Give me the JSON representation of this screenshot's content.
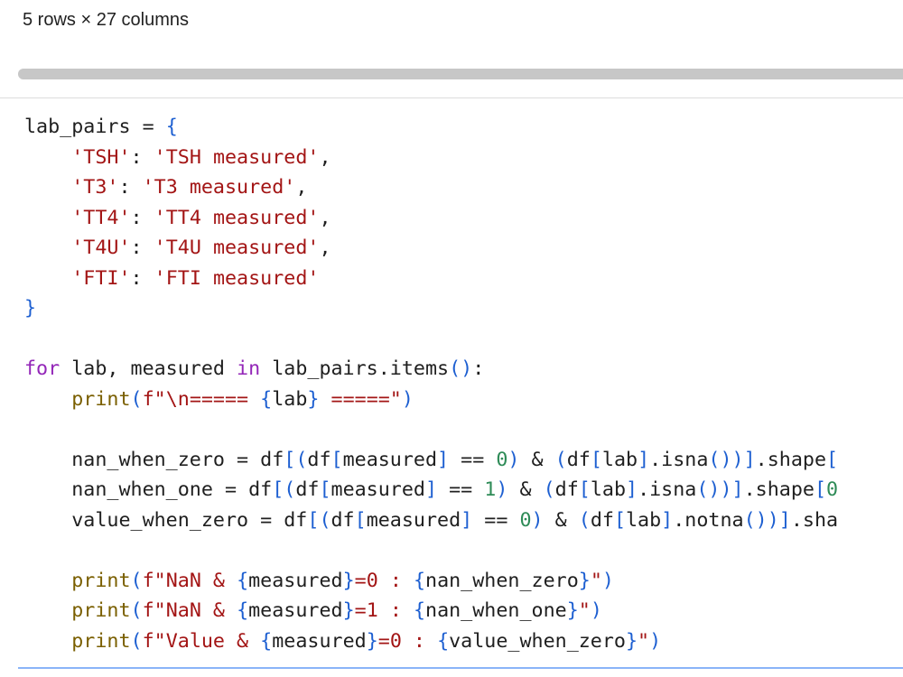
{
  "output": {
    "shape_info": "5 rows × 27 columns"
  },
  "code": {
    "lines": [
      "lab_pairs = {",
      "    'TSH': 'TSH measured',",
      "    'T3': 'T3 measured',",
      "    'TT4': 'TT4 measured',",
      "    'T4U': 'T4U measured',",
      "    'FTI': 'FTI measured'",
      "}",
      "",
      "for lab, measured in lab_pairs.items():",
      "    print(f\"\\n===== {lab} =====\")",
      "",
      "    nan_when_zero = df[(df[measured] == 0) & (df[lab].isna())].shape[",
      "    nan_when_one = df[(df[measured] == 1) & (df[lab].isna())].shape[0",
      "    value_when_zero = df[(df[measured] == 0) & (df[lab].notna())].sha",
      "",
      "    print(f\"NaN & {measured}=0 : {nan_when_zero}\")",
      "    print(f\"NaN & {measured}=1 : {nan_when_one}\")",
      "    print(f\"Value & {measured}=0 : {value_when_zero}\")"
    ]
  },
  "colors": {
    "keyword": "#9326b8",
    "bracket": "#1d5fd1",
    "string": "#a31515",
    "number": "#2e8b57",
    "function": "#7a5f00",
    "focus_border": "#8ab4f8"
  }
}
